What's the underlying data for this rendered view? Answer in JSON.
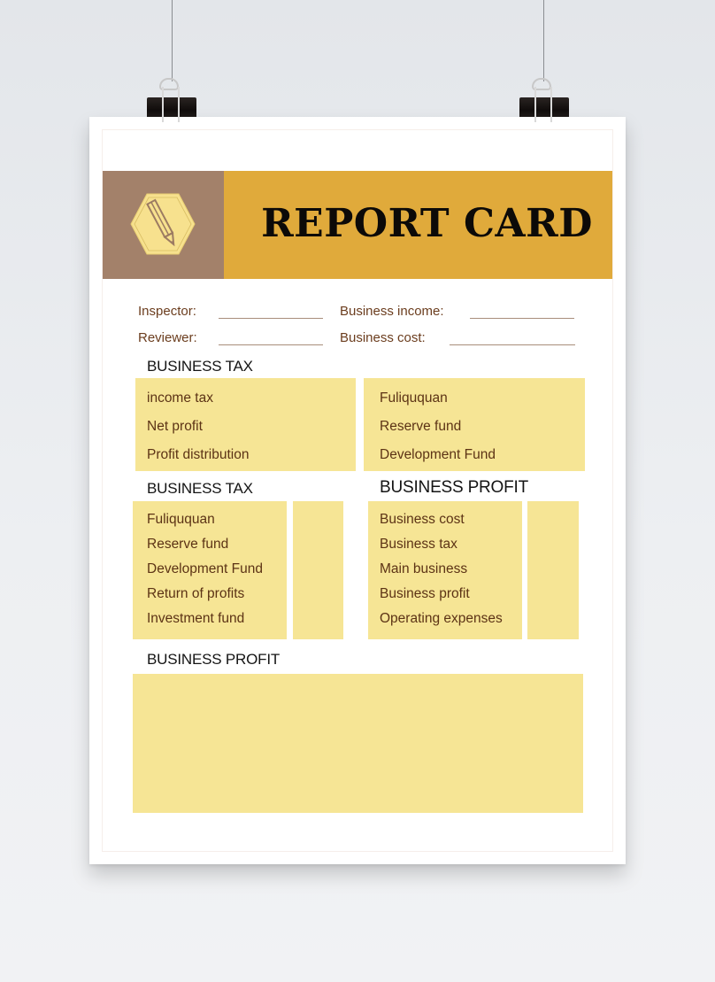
{
  "document": {
    "title": "REPORT CARD",
    "title_icon": "pencil-hexagon-icon",
    "colors": {
      "banner_left": "#a3816a",
      "banner_right": "#e0aa3b",
      "box_fill": "#f6e595",
      "label_text": "#6b3d1e"
    },
    "fields": [
      {
        "label": "Inspector:",
        "value": ""
      },
      {
        "label": "Business income:",
        "value": ""
      },
      {
        "label": "Reviewer:",
        "value": ""
      },
      {
        "label": "Business cost:",
        "value": ""
      }
    ],
    "section1": {
      "title": "BUSINESS TAX",
      "left_items": [
        "income tax",
        "Net profit",
        "Profit distribution"
      ],
      "right_items": [
        "Fuliququan",
        "Reserve fund",
        "Development Fund"
      ]
    },
    "section2": {
      "title": "BUSINESS TAX",
      "items": [
        "Fuliququan",
        "Reserve fund",
        "Development Fund",
        "Return of profits",
        "Investment fund"
      ]
    },
    "section3": {
      "title": "BUSINESS PROFIT",
      "items": [
        "Business cost",
        "Business tax",
        "Main business",
        "Business profit",
        "Operating expenses"
      ]
    },
    "section4": {
      "title": "BUSINESS PROFIT"
    }
  }
}
